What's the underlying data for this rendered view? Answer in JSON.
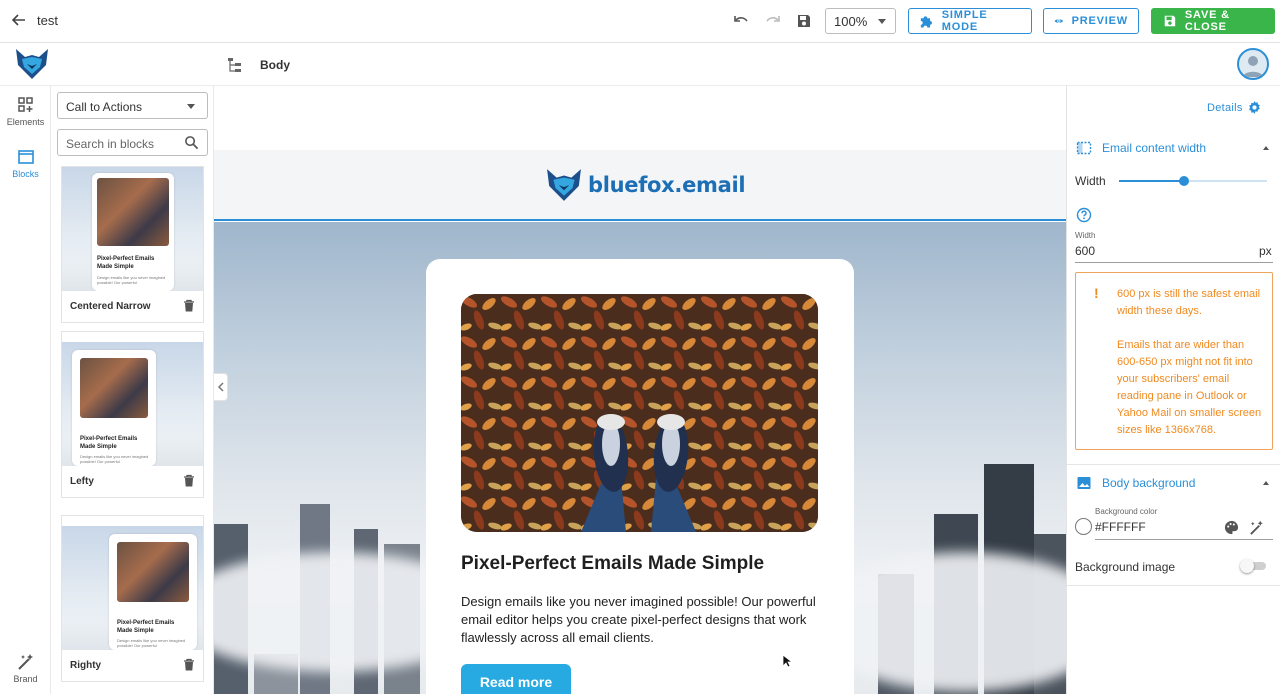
{
  "topbar": {
    "title": "test",
    "zoom": "100%",
    "simple_mode_label": "SIMPLE MODE",
    "preview_label": "PREVIEW",
    "save_close_label": "SAVE & CLOSE",
    "accent": "#2b8fd8",
    "save_color": "#3ab54a"
  },
  "subbar": {
    "breadcrumb": "Body"
  },
  "rail": {
    "items": [
      {
        "label": "Elements",
        "icon": "elements-icon"
      },
      {
        "label": "Blocks",
        "icon": "blocks-icon",
        "active": true
      },
      {
        "label": "Brand",
        "icon": "brand-wand-icon"
      }
    ]
  },
  "blocks_panel": {
    "category": "Call to Actions",
    "search_placeholder": "Search in blocks",
    "cards": [
      {
        "name": "Centered Narrow",
        "thumb_title": "Pixel-Perfect Emails Made Simple",
        "thumb_text": "Design emails like you never imagined possible! Our powerful"
      },
      {
        "name": "Lefty",
        "thumb_title": "Pixel-Perfect Emails Made Simple",
        "thumb_text": "Design emails like you never imagined possible! Our powerful"
      },
      {
        "name": "Righty",
        "thumb_title": "Pixel-Perfect Emails Made Simple",
        "thumb_text": "Design emails like you never imagined possible! Our powerful"
      }
    ]
  },
  "email": {
    "brand": "bluefox.email",
    "card_title": "Pixel-Perfect Emails Made Simple",
    "card_body": "Design emails like you never imagined possible! Our powerful email editor helps you create pixel-perfect designs that work flawlessly across all email clients.",
    "cta_label": "Read more",
    "cta_color": "#27aae1"
  },
  "right_panel": {
    "details_label": "Details",
    "width_section": {
      "title": "Email content width",
      "width_label": "Width",
      "slider_fraction": 0.44,
      "field_label": "Width",
      "value": "600",
      "unit": "px",
      "warning_lines": [
        "600 px is still the safest email width these days.",
        "Emails that are wider than 600-650 px might not fit into your subscribers' email reading pane in Outlook or Yahoo Mail on smaller screen sizes like 1366x768."
      ],
      "warning_color": "#ef8a1f"
    },
    "background_section": {
      "title": "Body background",
      "color_label": "Background color",
      "color_value": "#FFFFFF",
      "image_label": "Background image",
      "image_enabled": false
    }
  }
}
